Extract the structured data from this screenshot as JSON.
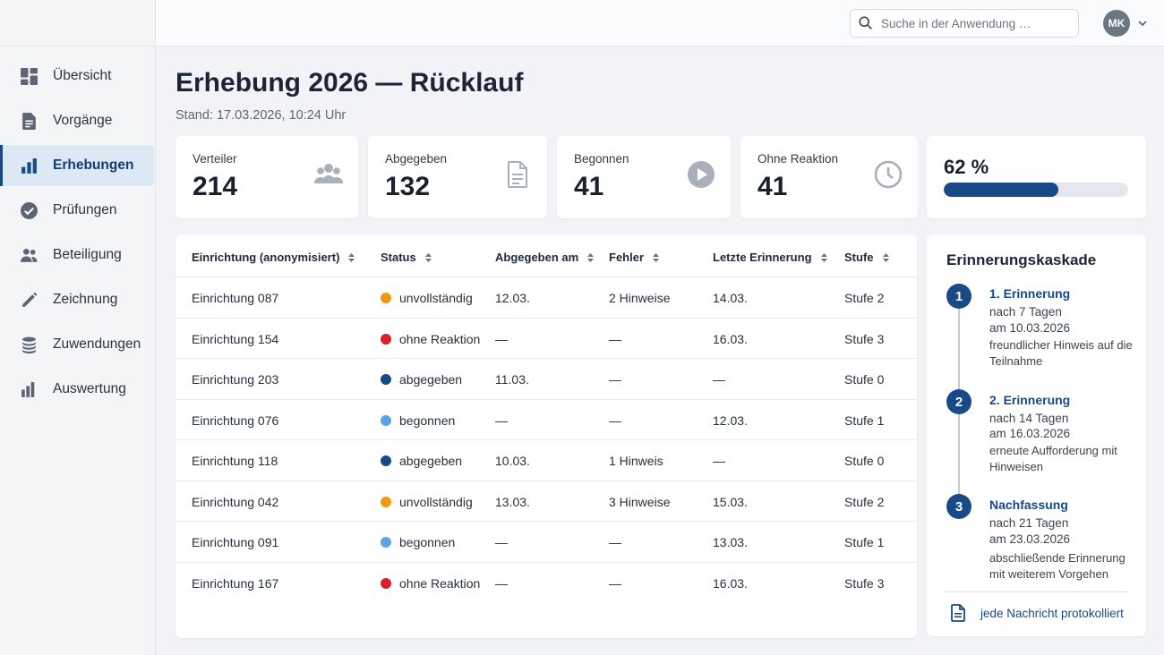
{
  "header": {
    "search_placeholder": "Suche in der Anwendung …",
    "user_initials": "MK"
  },
  "sidebar": {
    "items": [
      {
        "label": "Übersicht",
        "icon": "dashboard-icon"
      },
      {
        "label": "Vorgänge",
        "icon": "document-icon"
      },
      {
        "label": "Erhebungen",
        "icon": "bar-chart-icon",
        "active": true
      },
      {
        "label": "Prüfungen",
        "icon": "check-circle-icon"
      },
      {
        "label": "Beteiligung",
        "icon": "people-icon"
      },
      {
        "label": "Zeichnung",
        "icon": "pencil-icon"
      },
      {
        "label": "Zuwendungen",
        "icon": "coins-icon"
      },
      {
        "label": "Auswertung",
        "icon": "chart-icon"
      }
    ]
  },
  "page": {
    "title": "Erhebung 2026 — Rücklauf",
    "subtitle": "Stand: 17.03.2026, 10:24 Uhr"
  },
  "stats": [
    {
      "label": "Verteiler",
      "value": "214",
      "icon": "people-icon"
    },
    {
      "label": "Abgegeben",
      "value": "132",
      "icon": "document-icon"
    },
    {
      "label": "Begonnen",
      "value": "41",
      "icon": "play-icon"
    },
    {
      "label": "Ohne Reaktion",
      "value": "41",
      "icon": "clock-icon"
    }
  ],
  "progress": {
    "label": "62 %",
    "fraction": 0.62
  },
  "table": {
    "columns": [
      "Einrichtung (anonymisiert)",
      "Status",
      "Abgegeben am",
      "Fehler",
      "Letzte Erinnerung",
      "Stufe"
    ],
    "rows": [
      {
        "name": "Einrichtung 087",
        "status": "unvollständig",
        "status_color": "#f0960f",
        "submitted": "12.03.",
        "errors": "2 Hinweise",
        "reminder": "14.03.",
        "level": "Stufe 2"
      },
      {
        "name": "Einrichtung 154",
        "status": "ohne Reaktion",
        "status_color": "#d91f2a",
        "submitted": "—",
        "errors": "—",
        "reminder": "16.03.",
        "level": "Stufe 3"
      },
      {
        "name": "Einrichtung 203",
        "status": "abgegeben",
        "status_color": "#174a86",
        "submitted": "11.03.",
        "errors": "—",
        "reminder": "—",
        "level": "Stufe 0"
      },
      {
        "name": "Einrichtung 076",
        "status": "begonnen",
        "status_color": "#5aa4e6",
        "submitted": "—",
        "errors": "—",
        "reminder": "12.03.",
        "level": "Stufe 1"
      },
      {
        "name": "Einrichtung 118",
        "status": "abgegeben",
        "status_color": "#174a86",
        "submitted": "10.03.",
        "errors": "1 Hinweis",
        "reminder": "—",
        "level": "Stufe 0"
      },
      {
        "name": "Einrichtung 042",
        "status": "unvollständig",
        "status_color": "#f0960f",
        "submitted": "13.03.",
        "errors": "3 Hinweise",
        "reminder": "15.03.",
        "level": "Stufe 2"
      },
      {
        "name": "Einrichtung 091",
        "status": "begonnen",
        "status_color": "#5aa4e6",
        "submitted": "—",
        "errors": "—",
        "reminder": "13.03.",
        "level": "Stufe 1"
      },
      {
        "name": "Einrichtung 167",
        "status": "ohne Reaktion",
        "status_color": "#d91f2a",
        "submitted": "—",
        "errors": "—",
        "reminder": "16.03.",
        "level": "Stufe 3"
      }
    ]
  },
  "cascade": {
    "title": "Erinnerungskaskade",
    "steps": [
      {
        "num": "1",
        "title": "1. Erinnerung",
        "after": "nach 7 Tagen",
        "date": "am 10.03.2026",
        "note": "freundlicher Hinweis auf die Teilnahme"
      },
      {
        "num": "2",
        "title": "2. Erinnerung",
        "after": "nach 14 Tagen",
        "date": "am 16.03.2026",
        "note": "erneute Aufforderung mit Hinweisen"
      },
      {
        "num": "3",
        "title": "Nachfassung",
        "after": "nach 21 Tagen",
        "date": "am 23.03.2026",
        "note": "abschließende Erinnerung mit weiterem Vorgehen"
      }
    ],
    "footer": "jede Nachricht protokolliert"
  },
  "colors": {
    "accent": "#174a86",
    "active_nav_bg": "#dde8f5"
  }
}
